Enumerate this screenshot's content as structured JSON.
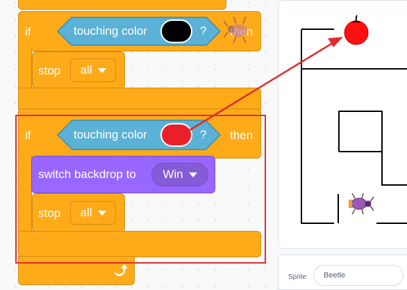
{
  "block_top": {
    "if_label": "if",
    "condition_label": "touching color",
    "condition_color": "#000000",
    "question_mark": "?",
    "then_label": "then",
    "stop_label": "stop",
    "stop_option": "all"
  },
  "block_main": {
    "if_label": "if",
    "condition_label": "touching color",
    "condition_color": "#e9202a",
    "question_mark": "?",
    "then_label": "then",
    "switch_label": "switch backdrop to",
    "backdrop_option": "Win",
    "stop_label": "stop",
    "stop_option": "all"
  },
  "colors": {
    "control_block": "#ffab19",
    "looks_block": "#9966ff",
    "sensing_block": "#5cb1d6",
    "highlight": "#e02b2b"
  },
  "icons": {
    "loop_arrow": "loop-arrow-icon",
    "stop_dropdown": "chevron-down-icon",
    "sprite_thumbnail": "beetle-icon",
    "target": "apple-icon"
  },
  "sprite_panel": {
    "label": "Sprite",
    "name_value": "Beetle"
  }
}
